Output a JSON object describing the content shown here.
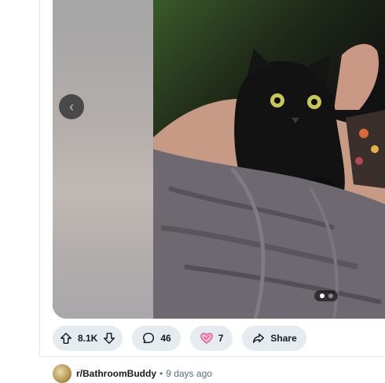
{
  "media": {
    "image_alt": "black cat sitting on a gray blanket",
    "carousel_prev_glyph": "‹",
    "slide_count": 2,
    "active_slide": 1
  },
  "actions": {
    "upvotes": "8.1K",
    "comments": "46",
    "awards": "7",
    "share_label": "Share"
  },
  "meta": {
    "subreddit": "r/BathroomBuddy",
    "separator": "•",
    "time_ago": "9 days ago"
  },
  "colors": {
    "pill_bg": "#e5ebee",
    "muted_text": "#576f76",
    "award_pink": "#e0528b"
  }
}
